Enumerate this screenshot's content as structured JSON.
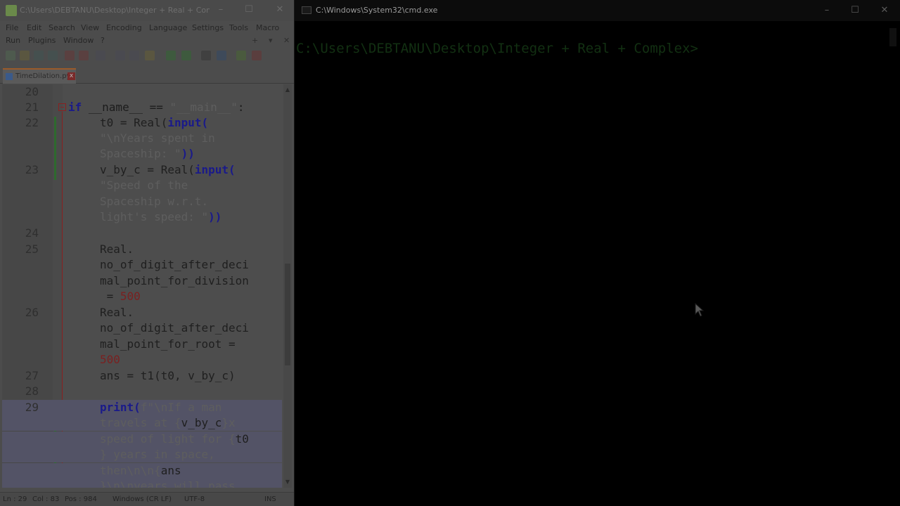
{
  "npp": {
    "title": "C:\\Users\\DEBTANU\\Desktop\\Integer + Real + Complex...",
    "menu_row1": [
      "File",
      "Edit",
      "Search",
      "View",
      "Encoding",
      "Language",
      "Settings",
      "Tools",
      "Macro"
    ],
    "menu_row2": [
      "Run",
      "Plugins",
      "Window",
      "?"
    ],
    "tab_label": "TimeDilation.py",
    "tab_close": "x",
    "lines": {
      "l20": "20",
      "l21": "21",
      "l22": "22",
      "l23": "23",
      "l24": "24",
      "l25": "25",
      "l26": "26",
      "l27": "27",
      "l28": "28",
      "l29": "29"
    },
    "code": {
      "c21a": "if",
      "c21b": " __name__ == ",
      "c21c": "\"__main__\"",
      "c21d": ":",
      "c22a": "t0 = Real(",
      "c22b": "input",
      "c22c": "(",
      "c22d": "\"\\nYears spent in",
      "c22e": "Spaceship: \"",
      "c22f": "))",
      "c23a": "v_by_c = Real(",
      "c23b": "input",
      "c23c": "(",
      "c23d": "\"Speed of the",
      "c23e": "Spaceship w.r.t.",
      "c23f": "light's speed: \"",
      "c23g": "))",
      "c25a": "Real.",
      "c25b": "no_of_digit_after_deci",
      "c25c": "mal_point_for_division",
      "c25d": " = ",
      "c25e": "500",
      "c26a": "Real.",
      "c26b": "no_of_digit_after_deci",
      "c26c": "mal_point_for_root =",
      "c26d": "500",
      "c27a": "ans = t1(t0, v_by_c)",
      "c29a": "print",
      "c29b": "(",
      "c29c": "f\"\\nIf a man",
      "c29d": "travels at {",
      "c29e": "v_by_c",
      "c29f": "}x",
      "c29g": "speed of light for {",
      "c29h": "t0",
      "c29i": "} years in space,",
      "c29j": "then\\n\\n{",
      "c29k": "ans",
      "c29l": "}\\n\\nyears will pass"
    },
    "status": {
      "ln": "Ln : 29",
      "col": "Col : 83",
      "pos": "Pos : 984",
      "eol": "Windows (CR LF)",
      "enc": "UTF-8",
      "mode": "INS"
    }
  },
  "cmd": {
    "title": "C:\\Windows\\System32\\cmd.exe",
    "prompt": "C:\\Users\\DEBTANU\\Desktop\\Integer + Real + Complex>"
  },
  "colors": {
    "overlay": "#000000",
    "prompt_green": "#123012"
  }
}
